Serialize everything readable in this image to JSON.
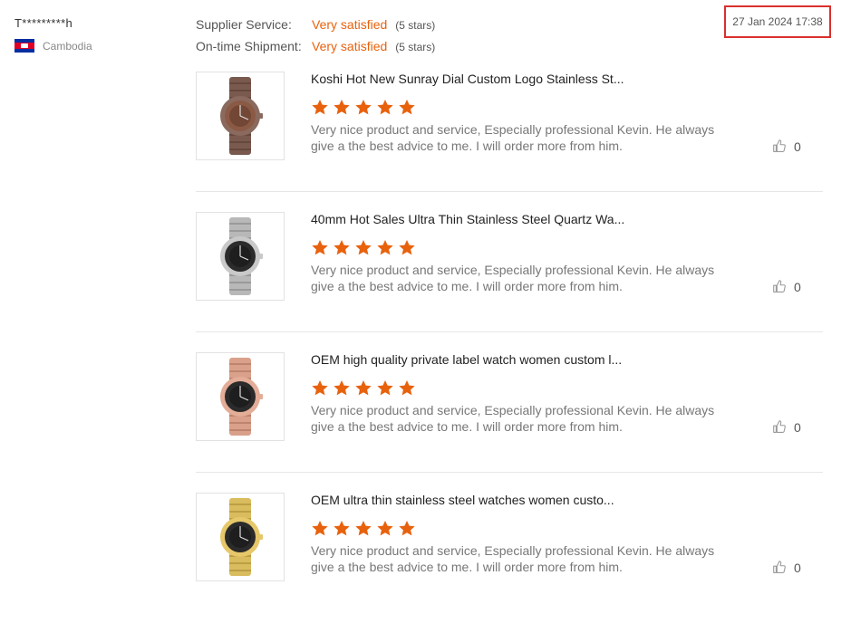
{
  "review": {
    "reviewer_name": "T*********h",
    "country": "Cambodia",
    "flag_icon": "cambodia-flag-icon",
    "supplier_service_label": "Supplier Service:",
    "supplier_service_value": "Very satisfied",
    "supplier_service_stars": "(5 stars)",
    "shipment_label": "On-time Shipment:",
    "shipment_value": "Very satisfied",
    "shipment_stars": "(5 stars)",
    "date": "27 Jan 2024 17:38"
  },
  "colors": {
    "accent": "#e8620e",
    "highlight_border": "#d9302c"
  },
  "products": [
    {
      "title": "Koshi Hot New Sunray Dial Custom Logo Stainless St...",
      "rating": 5,
      "comment": "Very nice product and service, Especially professional Kevin. He always give a the best advice to me. I will order more from him.",
      "likes": "0"
    },
    {
      "title": "40mm Hot Sales Ultra Thin Stainless Steel Quartz Wa...",
      "rating": 5,
      "comment": "Very nice product and service, Especially professional Kevin. He always give a the best advice to me. I will order more from him.",
      "likes": "0"
    },
    {
      "title": "OEM high quality private label watch women custom l...",
      "rating": 5,
      "comment": "Very nice product and service, Especially professional Kevin. He always give a the best advice to me. I will order more from him.",
      "likes": "0"
    },
    {
      "title": "OEM ultra thin stainless steel watches women custo...",
      "rating": 5,
      "comment": "Very nice product and service, Especially professional Kevin. He always give a the best advice to me. I will order more from him.",
      "likes": "0"
    }
  ]
}
